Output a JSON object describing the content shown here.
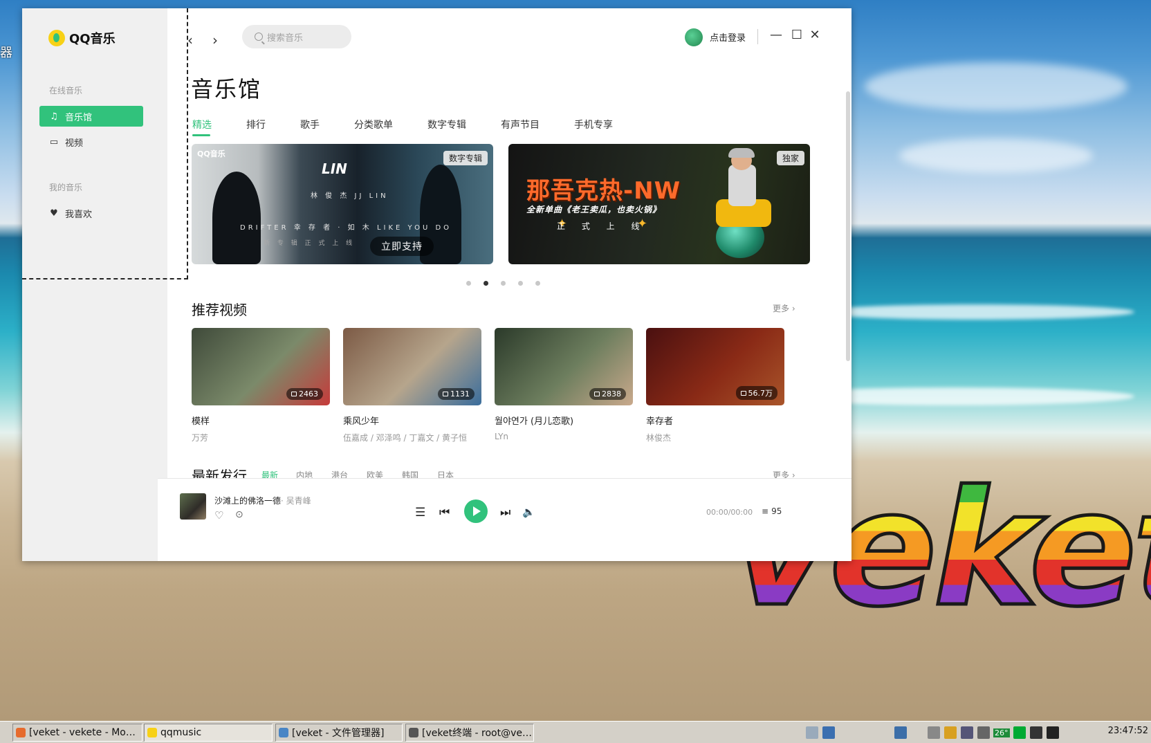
{
  "app": {
    "logo_text": "QQ音乐",
    "sidebar": {
      "online_section": "在线音乐",
      "online_items": [
        {
          "label": "音乐馆",
          "icon": "music-note-icon",
          "active": true
        },
        {
          "label": "视频",
          "icon": "video-icon",
          "active": false
        }
      ],
      "my_section": "我的音乐",
      "my_items": [
        {
          "label": "我喜欢",
          "icon": "heart-icon",
          "active": false
        }
      ]
    },
    "topbar": {
      "back": "‹",
      "forward": "›",
      "search_placeholder": "搜索音乐",
      "login_label": "点击登录",
      "minimize": "—",
      "maximize": "☐",
      "close": "✕"
    },
    "page_title": "音乐馆",
    "tabs": [
      "精选",
      "排行",
      "歌手",
      "分类歌单",
      "数字专辑",
      "有声节目",
      "手机专享"
    ],
    "active_tab": "精选",
    "banners": [
      {
        "badge": "数字专辑",
        "qq_tag": "QQ音乐",
        "logo": "LIN",
        "subtitle": "林 俊 杰  JJ LIN",
        "line": "DRIFTER 幸 存 者 · 如 ⽊ LIKE YOU DO",
        "line2": "新 专 辑 正 式 上 线",
        "button": "立即支持"
      },
      {
        "badge": "独家",
        "title": "那吾克热-NW",
        "subtitle": "全新单曲《老王卖瓜，也卖火锅》",
        "tagline": "正 式 上 线"
      }
    ],
    "carousel_dots": 5,
    "carousel_active": 1,
    "recommended_videos": {
      "title": "推荐视频",
      "more": "更多",
      "items": [
        {
          "title": "模样",
          "artist": "万芳",
          "count": "2463",
          "colors": [
            "#3f4a3a",
            "#7b8a6a",
            "#c63b3b"
          ]
        },
        {
          "title": "乘风少年",
          "artist": "伍嘉成 / 邓泽鸣 / 丁嘉文 / 黄子恒",
          "count": "1131",
          "colors": [
            "#7c5a45",
            "#b6a58c",
            "#3a6d9c"
          ]
        },
        {
          "title": "월야연가 (月儿恋歌)",
          "artist": "LYn",
          "count": "2838",
          "colors": [
            "#2b3a2a",
            "#6d7e5e",
            "#c9a98c"
          ]
        },
        {
          "title": "幸存者",
          "artist": "林俊杰",
          "count": "56.7万",
          "colors": [
            "#4a1010",
            "#8a2a16",
            "#a9552a"
          ]
        }
      ]
    },
    "new_releases": {
      "title": "最新发行",
      "more": "更多",
      "sub_tabs": [
        "最新",
        "内地",
        "港台",
        "欧美",
        "韩国",
        "日本"
      ],
      "active_sub_tab": "最新"
    },
    "player": {
      "song_title": "沙滩上的佛洛一德",
      "song_artist": "· 吴青峰",
      "time": "00:00/00:00",
      "playlist_count": "95"
    }
  },
  "desktop": {
    "logo_text": "veket",
    "edge_glyph": "器"
  },
  "taskbar": {
    "tasks": [
      {
        "label": "[veket - vekete - Mo…",
        "icon_color": "#e66b2d",
        "active": false
      },
      {
        "label": "qqmusic",
        "icon_color": "#f7d117",
        "active": true
      },
      {
        "label": "[veket - 文件管理器]",
        "icon_color": "#4a86c5",
        "active": false
      },
      {
        "label": "[veket终端 - root@ve…",
        "icon_color": "#555555",
        "active": false
      }
    ],
    "temperature": "26°",
    "clock": "23:47:52"
  }
}
